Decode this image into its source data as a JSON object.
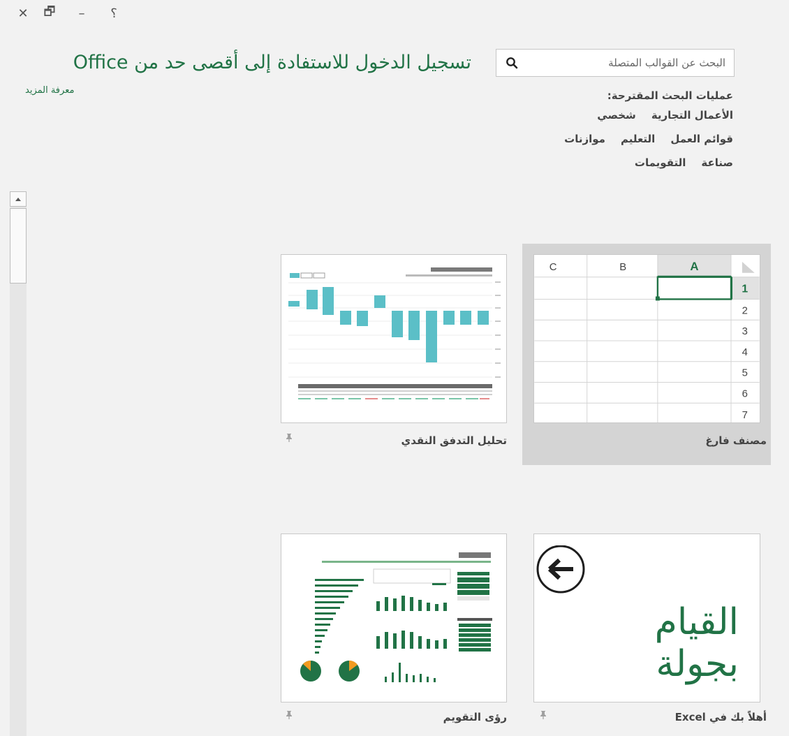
{
  "window_controls": {
    "close": "✕",
    "restore": "🗗",
    "minimize": "–",
    "help": "؟"
  },
  "header": {
    "signin_title": "تسجيل الدخول للاستفادة إلى أقصى حد من Office",
    "learn_more": "معرفة المزيد"
  },
  "search": {
    "placeholder": "البحث عن القوالب المتصلة",
    "icon": "search-icon"
  },
  "suggested": {
    "label": "عمليات البحث المقترحة:",
    "items": [
      "الأعمال التجارية",
      "شخصي",
      "قوائم العمل",
      "التعليم",
      "موازنات",
      "صناعة",
      "التقويمات"
    ]
  },
  "templates": [
    {
      "label": "مصنف فارغ",
      "selected": true
    },
    {
      "label": "تحليل التدفق النقدي",
      "pinned": false
    },
    {
      "label": "أهلاً بك في Excel",
      "pinned": false
    },
    {
      "label": "رؤى التقويم",
      "pinned": false
    }
  ],
  "blank_workbook": {
    "columns": [
      "A",
      "B",
      "C"
    ],
    "rows": [
      "1",
      "2",
      "3",
      "4",
      "5",
      "6",
      "7"
    ]
  },
  "tour": {
    "line1": "القيام",
    "line2": "بجولة"
  },
  "colors": {
    "accent": "#217346",
    "teal": "#5bbfc7",
    "orange": "#f29b21"
  },
  "icons": {
    "pin": "pin-icon",
    "arrow": "arrow-left-circle-icon"
  }
}
